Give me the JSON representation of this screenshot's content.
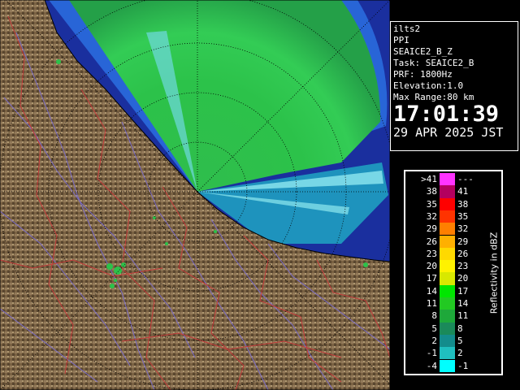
{
  "info": {
    "station": "ilts2",
    "scan_type": "PPI",
    "product": "SEAICE2_B_Z",
    "task": "Task: SEAICE2_B",
    "prf": "PRF: 1800Hz",
    "elevation": "Elevation:1.0",
    "max_range": "Max Range:80 km",
    "time": "17:01:39",
    "date": "29 APR 2025 JST"
  },
  "legend": {
    "unit": "Reflectivity in dBZ",
    "rows": [
      {
        "left": ">41",
        "right": "---",
        "color": "#ff33ff"
      },
      {
        "left": "38",
        "right": "41",
        "color": "#b3005f"
      },
      {
        "left": "35",
        "right": "38",
        "color": "#ff0000"
      },
      {
        "left": "32",
        "right": "35",
        "color": "#ff3300"
      },
      {
        "left": "29",
        "right": "32",
        "color": "#ff7f00"
      },
      {
        "left": "26",
        "right": "29",
        "color": "#ffb000"
      },
      {
        "left": "23",
        "right": "26",
        "color": "#ffd900"
      },
      {
        "left": "20",
        "right": "23",
        "color": "#fff200"
      },
      {
        "left": "17",
        "right": "20",
        "color": "#d8e800"
      },
      {
        "left": "14",
        "right": "17",
        "color": "#00e600"
      },
      {
        "left": "11",
        "right": "14",
        "color": "#22c922"
      },
      {
        "left": "8",
        "right": "11",
        "color": "#1ea83a"
      },
      {
        "left": "5",
        "right": "8",
        "color": "#1a8a5a"
      },
      {
        "left": "2",
        "right": "5",
        "color": "#138c8c"
      },
      {
        "left": "-1",
        "right": "2",
        "color": "#1fbfbf"
      },
      {
        "left": "-4",
        "right": "-1",
        "color": "#00ffff"
      }
    ]
  },
  "map_colors": {
    "sea": "#1a2f9e",
    "land": "#7a6243",
    "land_dark": "#4a3a26",
    "land_light": "#b09a74",
    "rivers": "#7a6cc8",
    "borders": "#c43a3a",
    "echo_green": "#2cc24a",
    "echo_cyan": "#1fbfbf"
  }
}
